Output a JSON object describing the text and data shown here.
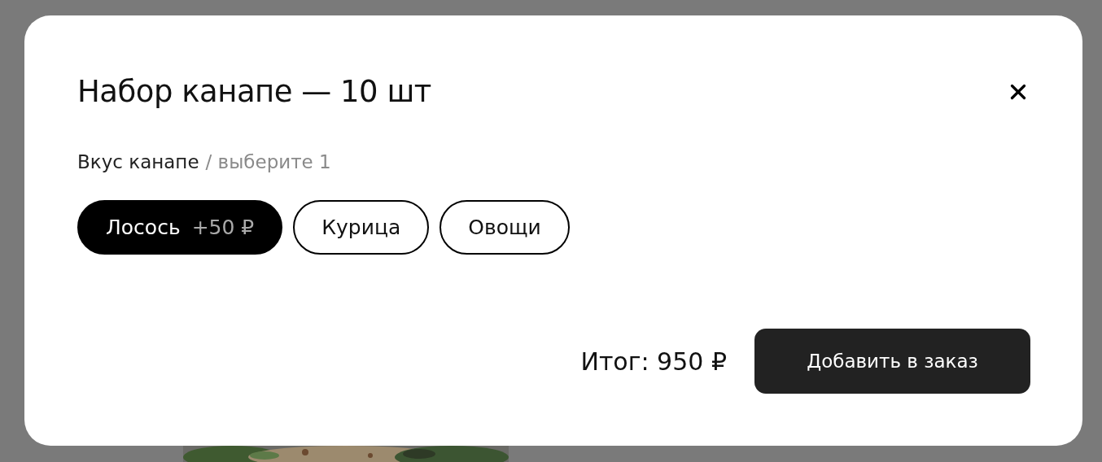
{
  "modal": {
    "title": "Набор канапе — 10 шт",
    "option_group": {
      "label": "Вкус канапе",
      "hint": "/ выберите 1",
      "options": [
        {
          "label": "Лосось",
          "price": "+50 ₽",
          "selected": true
        },
        {
          "label": "Курица",
          "selected": false
        },
        {
          "label": "Овощи",
          "selected": false
        }
      ]
    },
    "total": "Итог: 950 ₽",
    "submit": "Добавить в заказ"
  }
}
